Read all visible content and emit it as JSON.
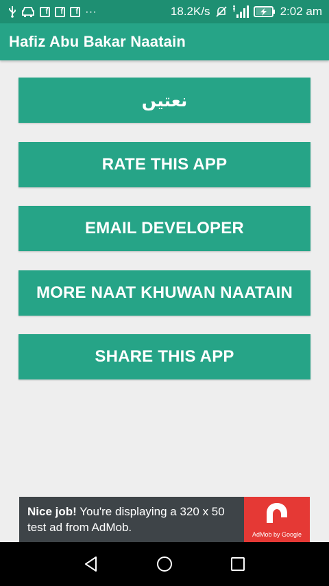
{
  "status_bar": {
    "network_speed": "18.2K/s",
    "time": "2:02 am",
    "more_indicator": "···",
    "fb_glyph": "f"
  },
  "app_bar": {
    "title": "Hafiz Abu Bakar Naatain"
  },
  "menu": {
    "buttons": [
      {
        "label": "نعتیں"
      },
      {
        "label": "RATE THIS APP"
      },
      {
        "label": "EMAIL DEVELOPER"
      },
      {
        "label": "MORE NAAT KHUWAN NAATAIN"
      },
      {
        "label": "SHARE THIS APP"
      }
    ]
  },
  "ad": {
    "bold_text": "Nice job!",
    "body_text": " You're displaying a 320 x 50 test ad from AdMob.",
    "logo_caption": "AdMob by Google"
  },
  "colors": {
    "status_bar": "#1e8f72",
    "primary": "#26a487",
    "background": "#eeeeee",
    "ad_background": "#3e4448",
    "ad_logo": "#e53935"
  },
  "icons": {
    "status_left": [
      "usb-icon",
      "car-icon",
      "facebook-icon",
      "facebook-icon",
      "facebook-icon",
      "more-notifications-icon"
    ],
    "status_right": [
      "no-sound-icon",
      "signal-icon",
      "battery-charging-icon"
    ],
    "navigation": [
      "back-icon",
      "home-icon",
      "recents-icon"
    ]
  }
}
